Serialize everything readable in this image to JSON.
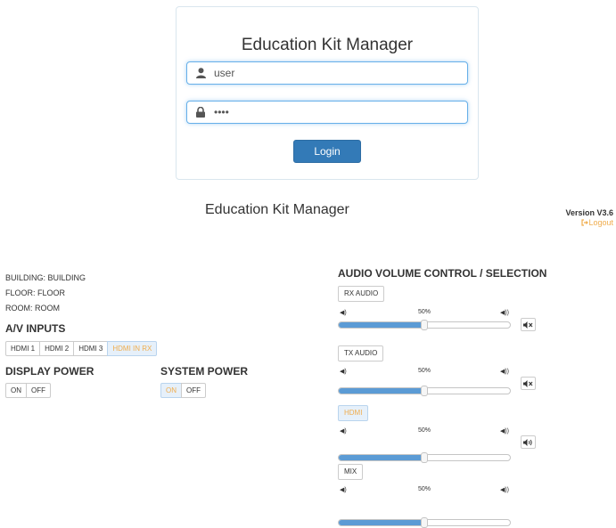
{
  "login": {
    "title": "Education Kit Manager",
    "username_value": "user",
    "password_value": "••••",
    "button_label": "Login"
  },
  "header": {
    "subtitle": "Education Kit Manager",
    "version": "Version V3.6",
    "logout_label": "Logout"
  },
  "location": {
    "building": "BUILDING: BUILDING",
    "floor": "FLOOR: FLOOR",
    "room": "ROOM: ROOM"
  },
  "av_inputs": {
    "heading": "A/V INPUTS",
    "buttons": [
      "HDMI 1",
      "HDMI 2",
      "HDMI 3",
      "HDMI IN RX"
    ],
    "selected": "HDMI IN RX"
  },
  "display_power": {
    "heading": "DISPLAY POWER",
    "on_label": "ON",
    "off_label": "OFF",
    "state": "none"
  },
  "system_power": {
    "heading": "SYSTEM POWER",
    "on_label": "ON",
    "off_label": "OFF",
    "state": "ON"
  },
  "audio": {
    "heading": "AUDIO VOLUME CONTROL / SELECTION",
    "channels": [
      {
        "label": "RX AUDIO",
        "selected": false,
        "volume_text": "50%",
        "volume": 0.5,
        "muted": true
      },
      {
        "label": "TX AUDIO",
        "selected": false,
        "volume_text": "50%",
        "volume": 0.5,
        "muted": true
      },
      {
        "label": "HDMI",
        "selected": true,
        "volume_text": "50%",
        "volume": 0.5,
        "muted": false
      },
      {
        "label": "MIX",
        "selected": false,
        "volume_text": "50%",
        "volume": 0.5,
        "muted": false
      }
    ]
  },
  "colors": {
    "primary": "#337ab7",
    "accent": "#f0ad4e",
    "slider_fill": "#5b9bd5",
    "focus": "#66afe9"
  },
  "icons": {
    "username": "user-icon",
    "password": "lock-icon",
    "volume_low": "volume-low-icon",
    "volume_high": "volume-high-icon",
    "mute": "volume-mute-icon",
    "unmute": "volume-up-icon",
    "logout": "logout-icon"
  }
}
